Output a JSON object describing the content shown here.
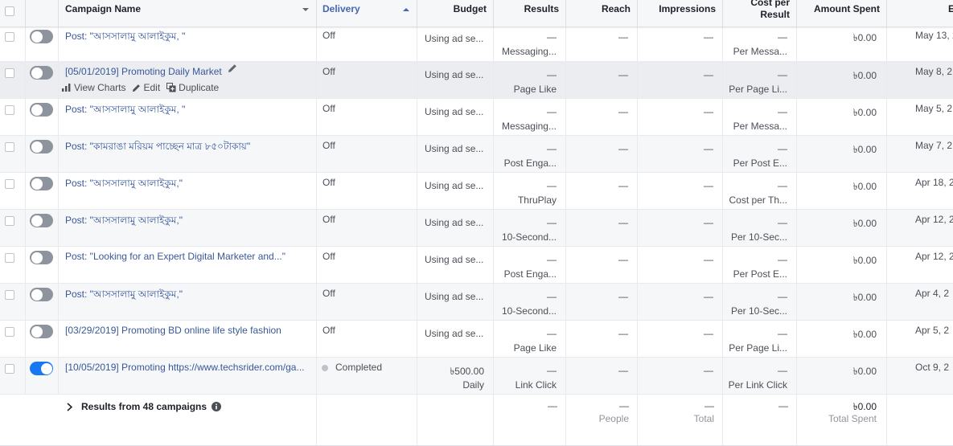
{
  "header": {
    "campaign_name": "Campaign Name",
    "delivery": "Delivery",
    "budget": "Budget",
    "results": "Results",
    "reach": "Reach",
    "impressions": "Impressions",
    "cost_per_result": "Cost per\nResult",
    "amount_spent": "Amount Spent",
    "ends": "E"
  },
  "row_actions": {
    "view_charts": "View Charts",
    "edit": "Edit",
    "duplicate": "Duplicate"
  },
  "rows": [
    {
      "on": false,
      "name": "Post: \"আসসালামু আলাইকুম, \"",
      "delivery": "Off",
      "budget": "Using ad se...",
      "result_value": "—",
      "result_type": "Messaging...",
      "reach": "—",
      "impressions": "—",
      "cpr_value": "—",
      "cpr_type": "Per Messa...",
      "amount": "৳0.00",
      "end": "May 13, 2"
    },
    {
      "on": false,
      "name": "[05/01/2019] Promoting Daily Market",
      "delivery": "Off",
      "budget": "Using ad se...",
      "result_value": "—",
      "result_type": "Page Like",
      "reach": "—",
      "impressions": "—",
      "cpr_value": "—",
      "cpr_type": "Per Page Li...",
      "amount": "৳0.00",
      "end": "May 8, 2"
    },
    {
      "on": false,
      "name": "Post: \"আসসালামু আলাইকুম, \"",
      "delivery": "Off",
      "budget": "Using ad se...",
      "result_value": "—",
      "result_type": "Messaging...",
      "reach": "—",
      "impressions": "—",
      "cpr_value": "—",
      "cpr_type": "Per Messa...",
      "amount": "৳0.00",
      "end": "May 5, 2"
    },
    {
      "on": false,
      "name": "Post: \"কামরাঙা মরিয়ম পাচ্ছেন মাত্র ৮৫০টাকায়\"",
      "delivery": "Off",
      "budget": "Using ad se...",
      "result_value": "—",
      "result_type": "Post Enga...",
      "reach": "—",
      "impressions": "—",
      "cpr_value": "—",
      "cpr_type": "Per Post E...",
      "amount": "৳0.00",
      "end": "May 7, 2"
    },
    {
      "on": false,
      "name": "Post: \"আসসালামু আলাইকুম,\"",
      "delivery": "Off",
      "budget": "Using ad se...",
      "result_value": "—",
      "result_type": "ThruPlay",
      "reach": "—",
      "impressions": "—",
      "cpr_value": "—",
      "cpr_type": "Cost per Th...",
      "amount": "৳0.00",
      "end": "Apr 18, 2"
    },
    {
      "on": false,
      "name": "Post: \"আসসালামু আলাইকুম,\"",
      "delivery": "Off",
      "budget": "Using ad se...",
      "result_value": "—",
      "result_type": "10-Second...",
      "reach": "—",
      "impressions": "—",
      "cpr_value": "—",
      "cpr_type": "Per 10-Sec...",
      "amount": "৳0.00",
      "end": "Apr 12, 2"
    },
    {
      "on": false,
      "name": "Post: \"Looking for an Expert Digital Marketer and...\"",
      "delivery": "Off",
      "budget": "Using ad se...",
      "result_value": "—",
      "result_type": "Post Enga...",
      "reach": "—",
      "impressions": "—",
      "cpr_value": "—",
      "cpr_type": "Per Post E...",
      "amount": "৳0.00",
      "end": "Apr 12, 2"
    },
    {
      "on": false,
      "name": "Post: \"আসসালামু আলাইকুম,\"",
      "delivery": "Off",
      "budget": "Using ad se...",
      "result_value": "—",
      "result_type": "10-Second...",
      "reach": "—",
      "impressions": "—",
      "cpr_value": "—",
      "cpr_type": "Per 10-Sec...",
      "amount": "৳0.00",
      "end": "Apr 4, 2"
    },
    {
      "on": false,
      "name": "[03/29/2019] Promoting BD online life style fashion",
      "delivery": "Off",
      "budget": "Using ad se...",
      "result_value": "—",
      "result_type": "Page Like",
      "reach": "—",
      "impressions": "—",
      "cpr_value": "—",
      "cpr_type": "Per Page Li...",
      "amount": "৳0.00",
      "end": "Apr 5, 2"
    },
    {
      "on": true,
      "name": "[10/05/2019] Promoting https://www.techsrider.com/ga...",
      "delivery": "Completed",
      "budget": "৳500.00",
      "budget_sub": "Daily",
      "result_value": "—",
      "result_type": "Link Click",
      "reach": "—",
      "impressions": "—",
      "cpr_value": "—",
      "cpr_type": "Per Link Click",
      "amount": "৳0.00",
      "end": "Oct 9, 2"
    }
  ],
  "summary": {
    "label": "Results from 48 campaigns",
    "results": "—",
    "reach": "—",
    "reach_sub": "People",
    "impressions": "—",
    "impressions_sub": "Total",
    "cpr": "—",
    "amount": "৳0.00",
    "amount_sub": "Total Spent"
  },
  "colors": {
    "link": "#385898",
    "toggle_on": "#1877f2",
    "toggle_off": "#8d949e",
    "delivery_header": "#4267b2"
  }
}
